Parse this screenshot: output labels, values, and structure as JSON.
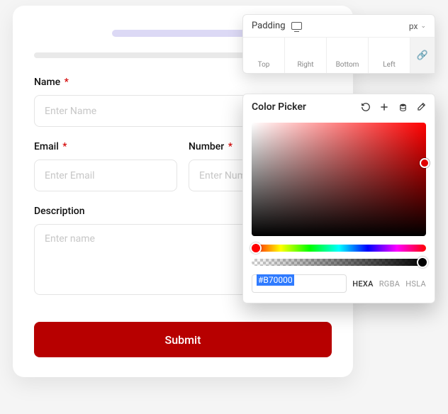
{
  "form": {
    "name_label": "Name",
    "name_placeholder": "Enter Name",
    "email_label": "Email",
    "email_placeholder": "Enter Email",
    "number_label": "Number",
    "number_placeholder": "Enter Number",
    "description_label": "Description",
    "description_placeholder": "Enter name",
    "submit_label": "Submit",
    "required_marker": "*"
  },
  "padding_panel": {
    "title": "Padding",
    "unit": "px",
    "sides": {
      "top": "Top",
      "right": "Right",
      "bottom": "Bottom",
      "left": "Left"
    },
    "values": {
      "top": "",
      "right": "",
      "bottom": "",
      "left": ""
    }
  },
  "color_picker": {
    "title": "Color Picker",
    "hex_value": "#B70000",
    "formats": [
      "HEXA",
      "RGBA",
      "HSLA"
    ],
    "active_format": "HEXA",
    "selected_color": "#B70000"
  }
}
